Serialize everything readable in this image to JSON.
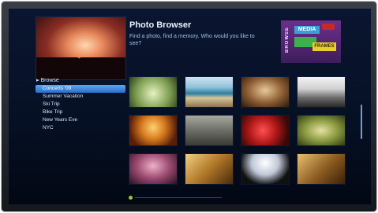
{
  "app": {
    "title": "Photo Browser",
    "subtitle": "Find a photo, find a memory. Who would you like to see?"
  },
  "logo": {
    "vertical_text": "BROWSE",
    "media_text": "MEDIA",
    "bottom_text": "FRAMES",
    "colors": {
      "purple": "#6c2f8c",
      "blue": "#3ca0d8",
      "green": "#3cb04c",
      "yellow": "#e8d02c",
      "red": "#c52a2a"
    }
  },
  "sidebar": {
    "header": "▸ Browse",
    "items": [
      {
        "label": "Concerts '09",
        "selected": true
      },
      {
        "label": "Summer Vacation",
        "selected": false
      },
      {
        "label": "Ski Trip",
        "selected": false
      },
      {
        "label": "Bike Trip",
        "selected": false
      },
      {
        "label": "New Years Eve",
        "selected": false
      },
      {
        "label": "NYC",
        "selected": false
      }
    ]
  },
  "grid": {
    "thumbnails": [
      {
        "name": "flower-thumb"
      },
      {
        "name": "beach-thumb"
      },
      {
        "name": "interior-thumb"
      },
      {
        "name": "snow-thumb"
      },
      {
        "name": "sunset-thumb"
      },
      {
        "name": "building-thumb"
      },
      {
        "name": "red-flowers-thumb"
      },
      {
        "name": "leaf-thumb"
      },
      {
        "name": "pink-thumb"
      },
      {
        "name": "gold-thumb"
      },
      {
        "name": "silhouette-thumb"
      },
      {
        "name": "abstract-thumb"
      }
    ]
  },
  "colors": {
    "accent": "#3c8de0",
    "background": "#061024",
    "status_dot": "#9ac83c"
  }
}
